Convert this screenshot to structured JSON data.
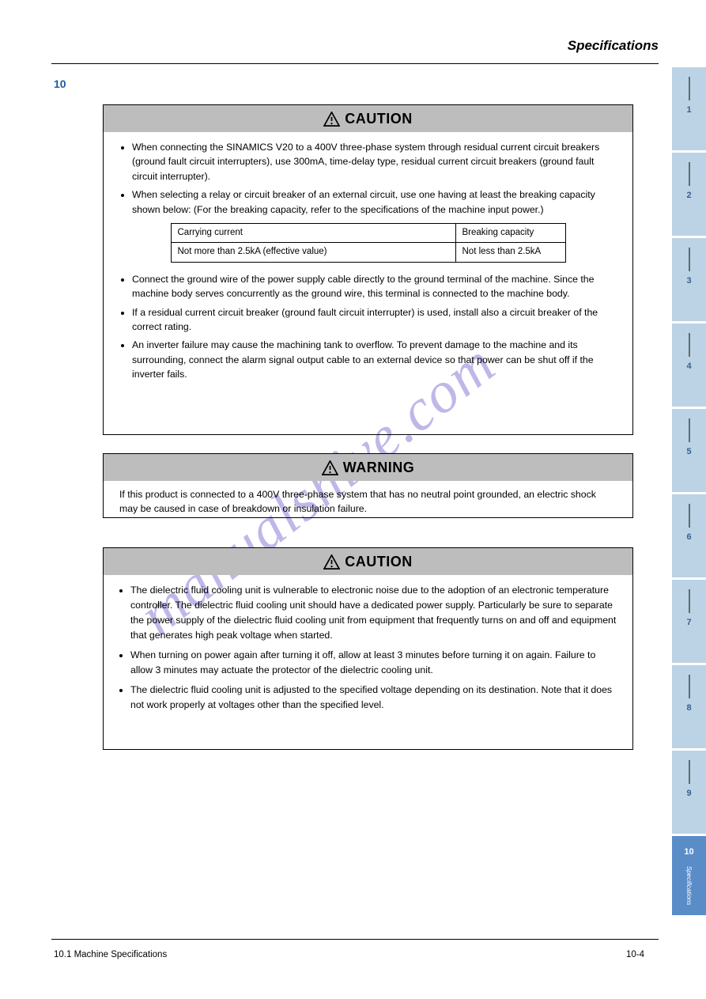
{
  "header": {
    "title": "Specifications",
    "section_number": "10"
  },
  "box1": {
    "header": "CAUTION",
    "bullets": [
      "When connecting the SINAMICS V20 to a 400V three-phase system through residual current circuit breakers (ground fault circuit interrupters), use 300mA, time-delay type, residual current circuit breakers (ground fault circuit interrupter).",
      "When selecting a relay or circuit breaker of an external circuit, use one having at least the breaking capacity shown below: (For the breaking capacity, refer to the specifications of the machine input power.)"
    ],
    "table": {
      "h1": "Carrying current",
      "h2": "Breaking capacity",
      "d1": "Not more than 2.5kA (effective value)",
      "d2": "Not less than 2.5kA"
    },
    "bullets2": [
      "Connect the ground wire of the power supply cable directly to the ground terminal of the machine. Since the machine body serves concurrently as the ground wire, this terminal is connected to the machine body.",
      "If a residual current circuit breaker (ground fault circuit interrupter) is used, install also a circuit breaker of the correct rating.",
      "An inverter failure may cause the machining tank to overflow. To prevent damage to the machine and its surrounding, connect the alarm signal output cable to an external device so that power can be shut off if the inverter fails."
    ]
  },
  "box2": {
    "header": "WARNING",
    "text": "If this product is connected to a 400V three-phase system that has no neutral point grounded, an electric shock may be caused in case of breakdown or insulation failure."
  },
  "box3": {
    "header": "CAUTION",
    "bullets": [
      "The dielectric fluid cooling unit is vulnerable to electronic noise due to the adoption of an electronic temperature controller. The dielectric fluid cooling unit should have a dedicated power supply. Particularly be sure to separate the power supply of the dielectric fluid cooling unit from equipment that frequently turns on and off and equipment that generates high peak voltage when started.",
      "When turning on power again after turning it off, allow at least 3 minutes before turning it on again. Failure to allow 3 minutes may actuate the protector of the dielectric cooling unit.",
      "The dielectric fluid cooling unit is adjusted to the specified voltage depending on its destination. Note that it does not work properly at voltages other than the specified level."
    ]
  },
  "tabs": [
    {
      "num": "1"
    },
    {
      "num": "2"
    },
    {
      "num": "3"
    },
    {
      "num": "4"
    },
    {
      "num": "5"
    },
    {
      "num": "6"
    },
    {
      "num": "7"
    },
    {
      "num": "8"
    },
    {
      "num": "9"
    },
    {
      "num": "10",
      "text": "Specifications",
      "active": true
    }
  ],
  "footer": {
    "left": "10.1  Machine Specifications",
    "right": "10-4"
  },
  "watermark": "manualshive.com"
}
